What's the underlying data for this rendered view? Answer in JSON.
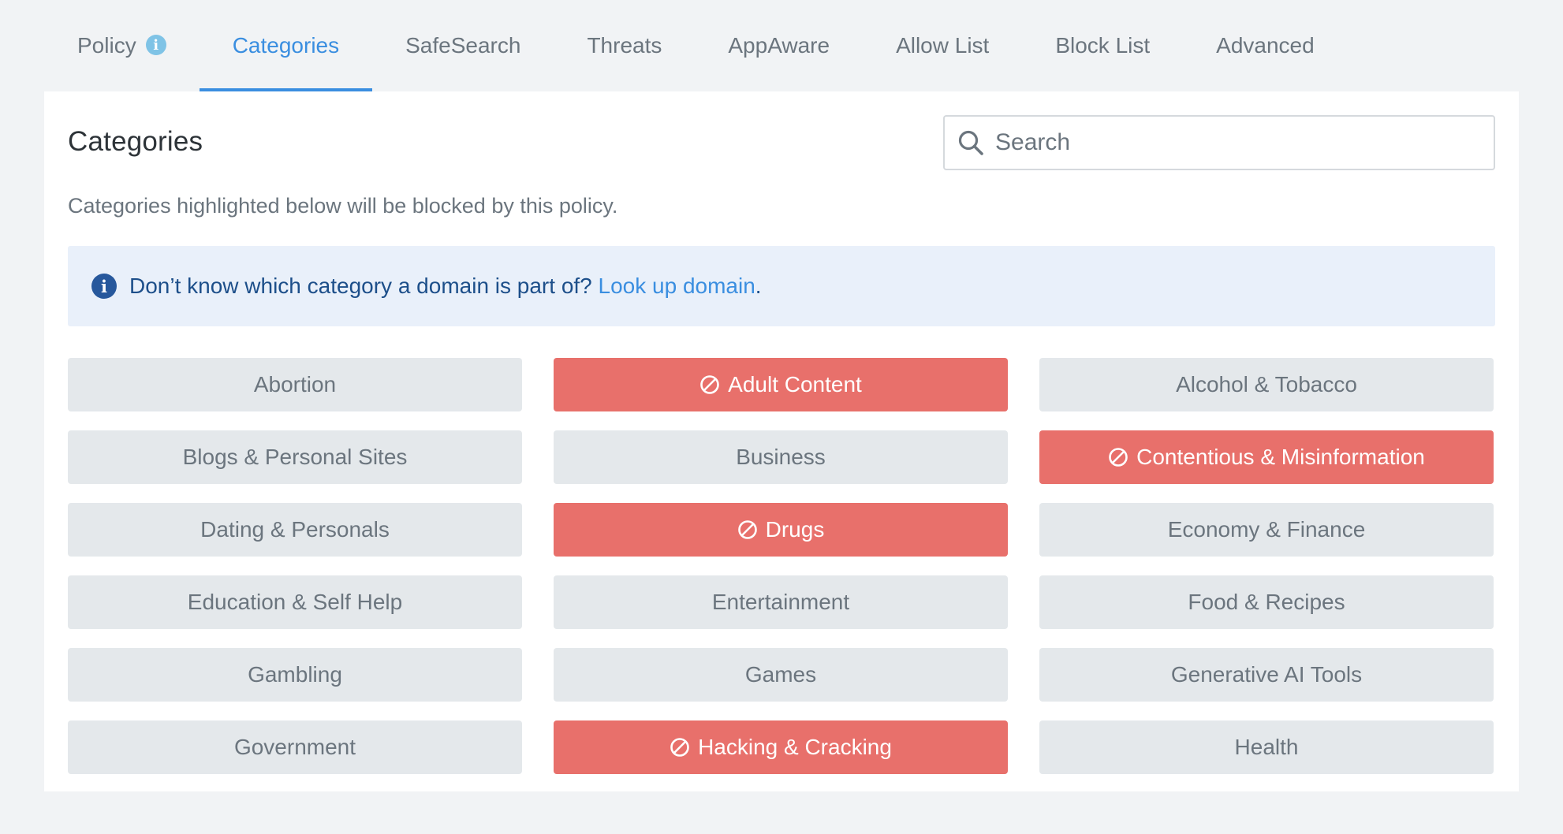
{
  "tabs": [
    {
      "label": "Policy",
      "active": false,
      "has_info_icon": true
    },
    {
      "label": "Categories",
      "active": true
    },
    {
      "label": "SafeSearch",
      "active": false
    },
    {
      "label": "Threats",
      "active": false
    },
    {
      "label": "AppAware",
      "active": false
    },
    {
      "label": "Allow List",
      "active": false
    },
    {
      "label": "Block List",
      "active": false
    },
    {
      "label": "Advanced",
      "active": false
    }
  ],
  "card": {
    "title": "Categories",
    "subtitle": "Categories highlighted below will be blocked by this policy."
  },
  "search": {
    "placeholder": "Search",
    "value": ""
  },
  "notice": {
    "text": "Don’t know which category a domain is part of? ",
    "link_text": "Look up domain",
    "suffix": "."
  },
  "categories": [
    {
      "label": "Abortion",
      "blocked": false
    },
    {
      "label": "Adult Content",
      "blocked": true
    },
    {
      "label": "Alcohol & Tobacco",
      "blocked": false
    },
    {
      "label": "Blogs & Personal Sites",
      "blocked": false
    },
    {
      "label": "Business",
      "blocked": false
    },
    {
      "label": "Contentious & Misinformation",
      "blocked": true
    },
    {
      "label": "Dating & Personals",
      "blocked": false
    },
    {
      "label": "Drugs",
      "blocked": true
    },
    {
      "label": "Economy & Finance",
      "blocked": false
    },
    {
      "label": "Education & Self Help",
      "blocked": false
    },
    {
      "label": "Entertainment",
      "blocked": false
    },
    {
      "label": "Food & Recipes",
      "blocked": false
    },
    {
      "label": "Gambling",
      "blocked": false
    },
    {
      "label": "Games",
      "blocked": false
    },
    {
      "label": "Generative AI Tools",
      "blocked": false
    },
    {
      "label": "Government",
      "blocked": false
    },
    {
      "label": "Hacking & Cracking",
      "blocked": true
    },
    {
      "label": "Health",
      "blocked": false
    }
  ],
  "icons": {
    "search": "search-icon",
    "info": "info-icon",
    "blocked": "block-icon"
  },
  "colors": {
    "accent": "#3a8ee0",
    "blocked": "#e8706b",
    "unblocked": "#e4e8eb",
    "notice_bg": "#e9f0fa"
  }
}
